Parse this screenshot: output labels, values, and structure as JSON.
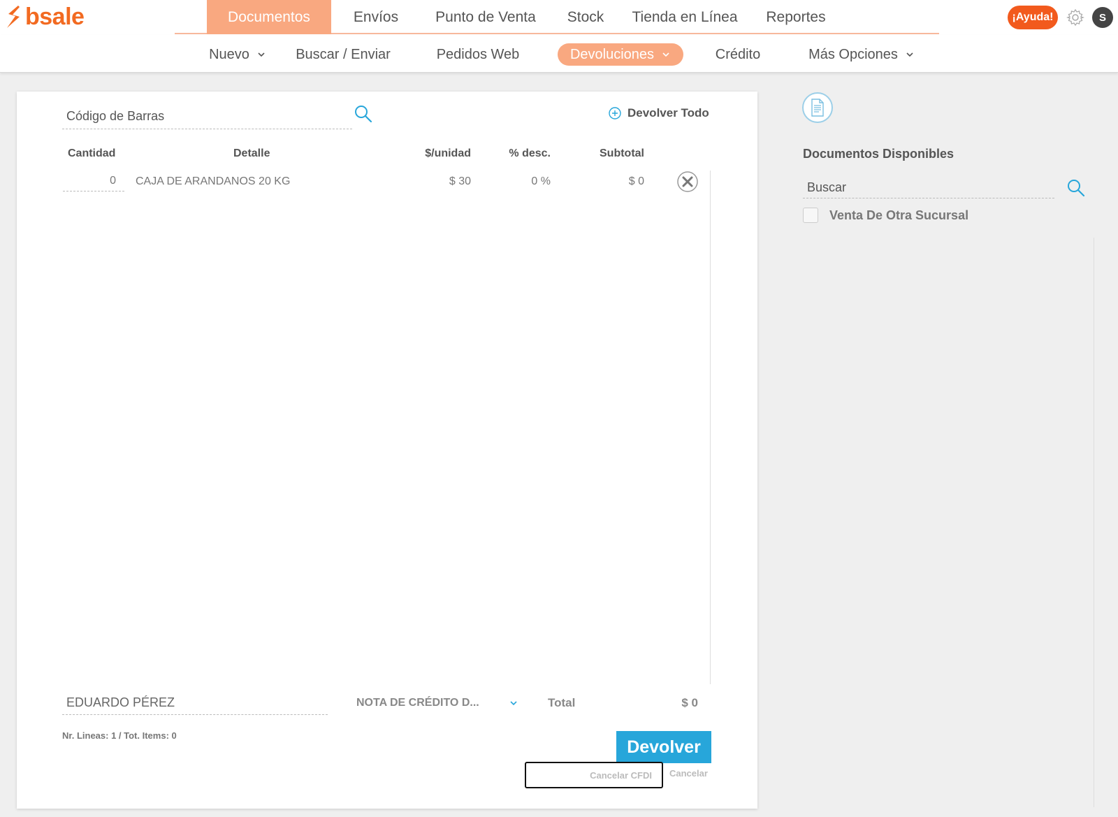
{
  "brand": {
    "logo_text": "bsale",
    "accent": "#f26a21"
  },
  "main_nav": {
    "items": [
      {
        "label": "Documentos",
        "active": true
      },
      {
        "label": "Envíos",
        "active": false
      },
      {
        "label": "Punto de Venta",
        "active": false
      },
      {
        "label": "Stock",
        "active": false
      },
      {
        "label": "Tienda en Línea",
        "active": false
      },
      {
        "label": "Reportes",
        "active": false
      }
    ]
  },
  "header_right": {
    "help_label": "¡Ayuda!",
    "settings_icon": "gear-icon",
    "avatar_initial": "S"
  },
  "sub_nav": {
    "items": [
      {
        "label": "Nuevo",
        "has_dropdown": true,
        "active": false
      },
      {
        "label": "Buscar / Enviar",
        "has_dropdown": false,
        "active": false
      },
      {
        "label": "Pedidos Web",
        "has_dropdown": false,
        "active": false
      },
      {
        "label": "Devoluciones",
        "has_dropdown": true,
        "active": true
      },
      {
        "label": "Crédito",
        "has_dropdown": false,
        "active": false
      },
      {
        "label": "Más Opciones",
        "has_dropdown": true,
        "active": false
      }
    ]
  },
  "returns": {
    "barcode_placeholder": "Código de Barras",
    "return_all_label": "Devolver Todo",
    "columns": {
      "quantity": "Cantidad",
      "detail": "Detalle",
      "unit_price": "$/unidad",
      "discount": "% desc.",
      "subtotal": "Subtotal"
    },
    "rows": [
      {
        "quantity": "0",
        "detail": "CAJA DE ARANDANOS 20 KG",
        "unit_price": "$ 30",
        "discount": "0 %",
        "subtotal": "$ 0"
      }
    ],
    "client_value": "EDUARDO PÉREZ",
    "document_type": "NOTA DE CRÉDITO D...",
    "total_label": "Total",
    "total_value": "$ 0",
    "lines_info": "Nr. Lineas: 1 / Tot. Items: 0",
    "return_button": "Devolver",
    "cancel_cfdi_label": "Cancelar CFDI",
    "cancel_label": "Cancelar"
  },
  "available_docs": {
    "title": "Documentos Disponibles",
    "search_placeholder": "Buscar",
    "other_branch_label": "Venta De Otra Sucursal",
    "other_branch_checked": false
  },
  "colors": {
    "primary_blue": "#27a6da",
    "nav_active": "#f9a880",
    "help_red": "#f25a1d"
  }
}
